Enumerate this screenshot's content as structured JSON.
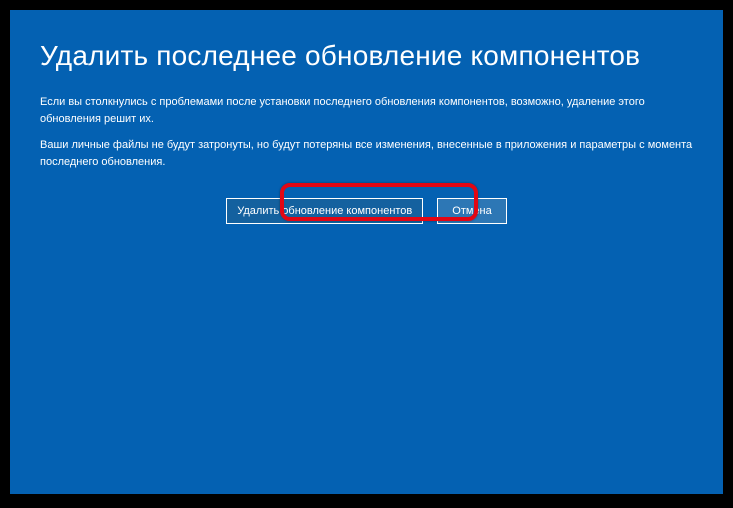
{
  "title": "Удалить последнее обновление компонентов",
  "description1": "Если вы столкнулись с проблемами после установки последнего обновления компонентов, возможно, удаление этого обновления решит их.",
  "description2": "Ваши личные файлы не будут затронуты, но будут потеряны все изменения, внесенные в приложения и параметры с момента последнего обновления.",
  "buttons": {
    "primary": "Удалить обновление компонентов",
    "cancel": "Отмена"
  }
}
